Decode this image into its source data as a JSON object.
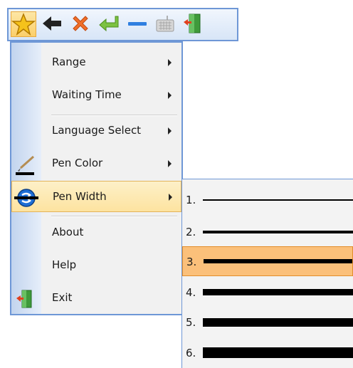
{
  "toolbar": {
    "buttons": [
      {
        "name": "star-icon",
        "active": true
      },
      {
        "name": "back-arrow-icon"
      },
      {
        "name": "close-icon"
      },
      {
        "name": "enter-icon"
      },
      {
        "name": "minimize-icon"
      },
      {
        "name": "keyboard-icon"
      },
      {
        "name": "exit-door-icon"
      }
    ]
  },
  "menu": {
    "range": "Range",
    "waiting_time": "Waiting Time",
    "language_select": "Language Select",
    "pen_color": "Pen Color",
    "pen_width": "Pen Width",
    "about": "About",
    "help": "Help",
    "exit": "Exit"
  },
  "submenu": {
    "selected_index": 3,
    "items": [
      {
        "label": "1.",
        "width": 2
      },
      {
        "label": "2.",
        "width": 4
      },
      {
        "label": "3.",
        "width": 6
      },
      {
        "label": "4.",
        "width": 9
      },
      {
        "label": "5.",
        "width": 12
      },
      {
        "label": "6.",
        "width": 15
      }
    ]
  },
  "colors": {
    "border_blue": "#6e97d6",
    "highlight": "#fbc07a",
    "hover": "#fde3a0"
  }
}
